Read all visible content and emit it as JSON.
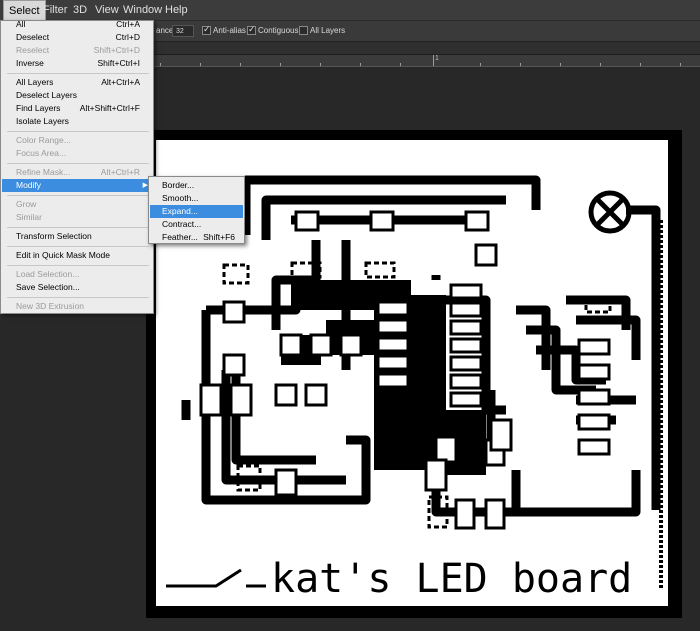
{
  "menubar": {
    "items": [
      {
        "label": "Select",
        "active": true
      },
      {
        "label": "Filter"
      },
      {
        "label": "3D"
      },
      {
        "label": "View"
      },
      {
        "label": "Window"
      },
      {
        "label": "Help"
      }
    ]
  },
  "options_bar": {
    "tolerance_label": "ance:",
    "tolerance_value": "32",
    "anti_alias_label": "Anti-alias",
    "anti_alias_checked": true,
    "contiguous_label": "Contiguous",
    "contiguous_checked": true,
    "all_layers_label": "All Layers",
    "all_layers_checked": false
  },
  "ruler": {
    "marker": "1"
  },
  "select_menu": {
    "items": [
      {
        "label": "All",
        "shortcut": "Ctrl+A",
        "enabled": true
      },
      {
        "label": "Deselect",
        "shortcut": "Ctrl+D",
        "enabled": true
      },
      {
        "label": "Reselect",
        "shortcut": "Shift+Ctrl+D",
        "enabled": false
      },
      {
        "label": "Inverse",
        "shortcut": "Shift+Ctrl+I",
        "enabled": true
      },
      {
        "label": "All Layers",
        "shortcut": "Alt+Ctrl+A",
        "enabled": true
      },
      {
        "label": "Deselect Layers",
        "shortcut": "",
        "enabled": true
      },
      {
        "label": "Find Layers",
        "shortcut": "Alt+Shift+Ctrl+F",
        "enabled": true
      },
      {
        "label": "Isolate Layers",
        "shortcut": "",
        "enabled": true
      },
      {
        "label": "Color Range...",
        "shortcut": "",
        "enabled": false
      },
      {
        "label": "Focus Area...",
        "shortcut": "",
        "enabled": false
      },
      {
        "label": "Refine Mask...",
        "shortcut": "Alt+Ctrl+R",
        "enabled": false
      },
      {
        "label": "Modify",
        "shortcut": "",
        "enabled": true,
        "submenu": true,
        "highlighted": true
      },
      {
        "label": "Grow",
        "shortcut": "",
        "enabled": false
      },
      {
        "label": "Similar",
        "shortcut": "",
        "enabled": false
      },
      {
        "label": "Transform Selection",
        "shortcut": "",
        "enabled": true
      },
      {
        "label": "Edit in Quick Mask Mode",
        "shortcut": "",
        "enabled": true
      },
      {
        "label": "Load Selection...",
        "shortcut": "",
        "enabled": false
      },
      {
        "label": "Save Selection...",
        "shortcut": "",
        "enabled": true
      },
      {
        "label": "New 3D Extrusion",
        "shortcut": "",
        "enabled": false
      }
    ]
  },
  "modify_submenu": {
    "items": [
      {
        "label": "Border...",
        "shortcut": ""
      },
      {
        "label": "Smooth...",
        "shortcut": ""
      },
      {
        "label": "Expand...",
        "shortcut": "",
        "highlighted": true
      },
      {
        "label": "Contract...",
        "shortcut": ""
      },
      {
        "label": "Feather...",
        "shortcut": "Shift+F6"
      }
    ]
  },
  "canvas": {
    "board_text": "kat's LED board"
  },
  "colors": {
    "ui_dark": "#282828",
    "menu_bg": "#ececec",
    "highlight": "#3c8ce0",
    "board_black": "#000000",
    "board_white": "#ffffff"
  }
}
